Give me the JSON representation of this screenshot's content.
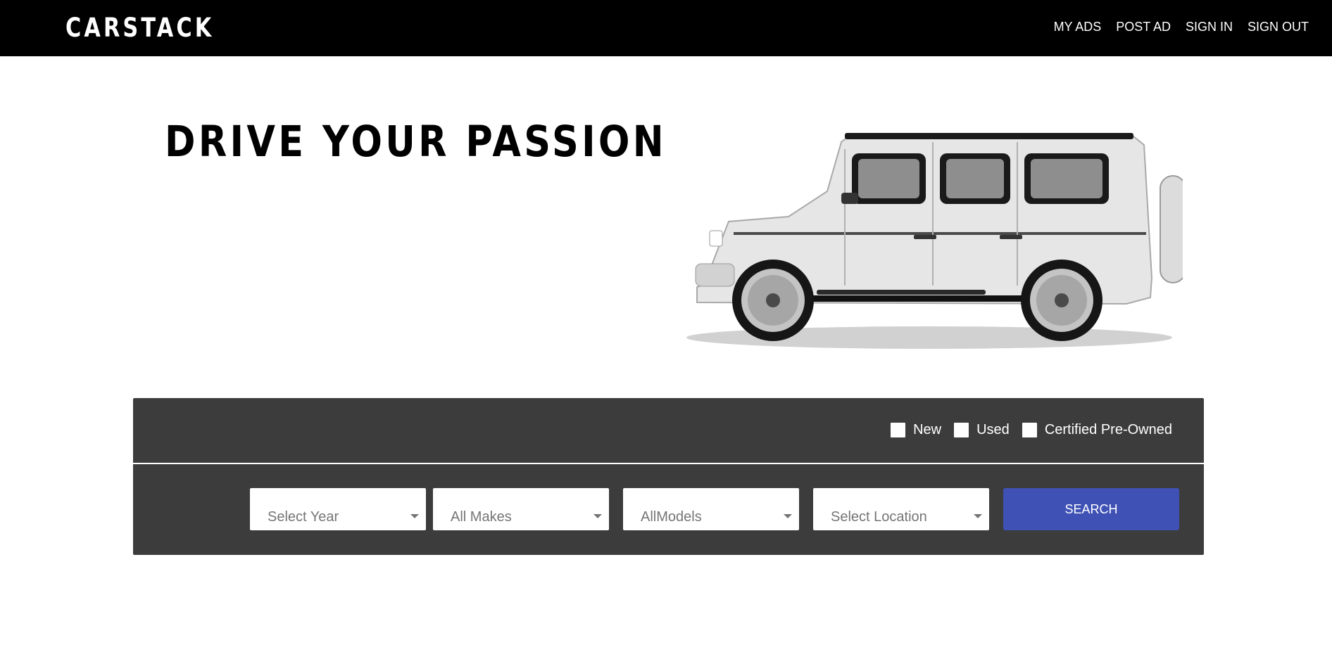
{
  "nav": {
    "brand": "CARSTACK",
    "links": [
      "MY ADS",
      "POST AD",
      "SIGN IN",
      "SIGN OUT"
    ]
  },
  "hero": {
    "heading": "DRIVE YOUR PASSION"
  },
  "search": {
    "conditions": [
      "New",
      "Used",
      "Certified Pre-Owned"
    ],
    "year_placeholder": "Select Year",
    "make_placeholder": "All Makes",
    "model_placeholder": "AllModels",
    "location_placeholder": "Select Location",
    "button_label": "SEARCH"
  },
  "colors": {
    "nav_background": "#000000",
    "panel_background": "#3c3c3c",
    "search_button": "#3f51b5"
  },
  "icons": [
    "car-image",
    "chevron-down-icon"
  ]
}
